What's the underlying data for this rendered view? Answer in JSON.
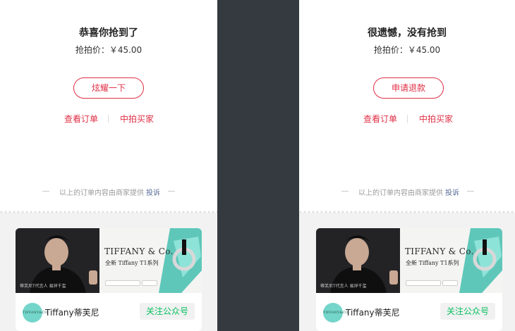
{
  "left_panel": {
    "title": "恭喜你抢到了",
    "price": "抢拍价：￥45.00",
    "action_button": "炫耀一下",
    "link_view_order": "查看订单",
    "link_buyers": "中拍买家",
    "provider_text": "以上的订单内容由商家提供",
    "complain_link": "投诉"
  },
  "right_panel": {
    "title": "很遗憾，没有抢到",
    "price": "抢拍价：￥45.00",
    "action_button": "申请退款",
    "link_view_order": "查看订单",
    "link_buyers": "中拍买家",
    "provider_text": "以上的订单内容由商家提供",
    "complain_link": "投诉"
  },
  "ad": {
    "brand_name": "TIFFANY & Co.",
    "brand_subtitle": "全新 Tiffany T1系列",
    "photo_caption": "蒂芙尼T代言人 易烊千玺",
    "logo_text": "TIFFANY&CO.",
    "account_name": "Tiffany蒂芙尼",
    "follow_button": "关注公众号"
  },
  "colors": {
    "accent": "#e02f45",
    "follow_green": "#07c160",
    "link_blue": "#576b95",
    "divider_bar": "#343a3f",
    "footer_bg": "#f2f2f2"
  }
}
